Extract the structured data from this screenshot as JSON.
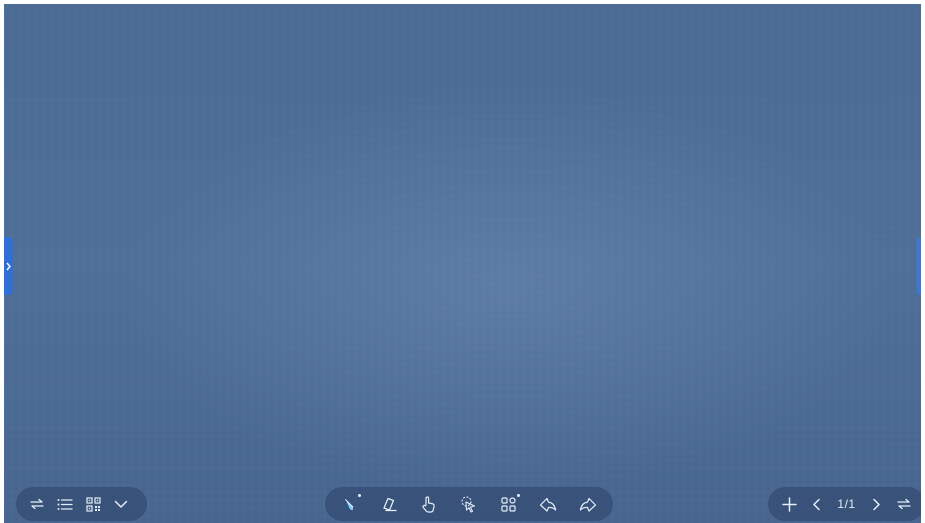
{
  "bottom_left_toolbar": {
    "items": [
      {
        "icon": "swap-arrows-icon"
      },
      {
        "icon": "list-icon"
      },
      {
        "icon": "qr-code-icon"
      },
      {
        "icon": "chevron-down-icon"
      }
    ]
  },
  "bottom_center_toolbar": {
    "items": [
      {
        "icon": "pen-icon",
        "selected": true,
        "has_submenu": true
      },
      {
        "icon": "eraser-icon"
      },
      {
        "icon": "hand-pointer-icon"
      },
      {
        "icon": "select-pointer-icon"
      },
      {
        "icon": "apps-grid-icon",
        "has_submenu": true
      },
      {
        "icon": "undo-icon"
      },
      {
        "icon": "redo-icon"
      }
    ]
  },
  "bottom_right_toolbar": {
    "page_indicator": "1/1",
    "items": [
      {
        "icon": "plus-icon"
      },
      {
        "icon": "chevron-left-icon"
      },
      {
        "icon": "chevron-right-icon"
      },
      {
        "icon": "swap-arrows-icon"
      }
    ]
  },
  "colors": {
    "canvas": "#4e6e98",
    "toolbar_bg": "#2c4268",
    "side_tab": "#2f6fd6",
    "pen_accent": "#7fd3ff"
  }
}
